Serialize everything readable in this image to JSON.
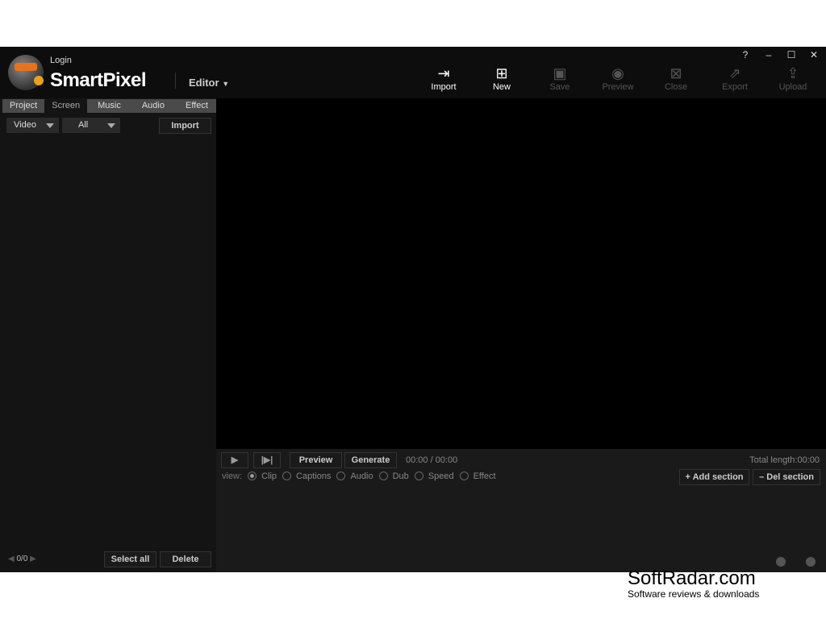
{
  "header": {
    "login": "Login",
    "brand": "SmartPixel",
    "mode": "Editor",
    "toolbar": [
      {
        "label": "Import",
        "icon": "import-icon",
        "enabled": true
      },
      {
        "label": "New",
        "icon": "new-file-icon",
        "enabled": true
      },
      {
        "label": "Save",
        "icon": "save-icon",
        "enabled": false
      },
      {
        "label": "Preview",
        "icon": "eye-icon",
        "enabled": false
      },
      {
        "label": "Close",
        "icon": "close-file-icon",
        "enabled": false
      },
      {
        "label": "Export",
        "icon": "export-icon",
        "enabled": false
      },
      {
        "label": "Upload",
        "icon": "upload-icon",
        "enabled": false
      }
    ],
    "window_controls": {
      "help": "?",
      "minimize": "–",
      "maximize": "☐",
      "close": "✕"
    }
  },
  "left": {
    "tabs": [
      "Project",
      "Screen",
      "Music",
      "Audio",
      "Effect"
    ],
    "active_tab": "Screen",
    "type_select": "Video",
    "filter_select": "All",
    "import": "Import",
    "page": "0/0",
    "select_all": "Select all",
    "delete": "Delete"
  },
  "timeline": {
    "preview": "Preview",
    "generate": "Generate",
    "time": "00:00 / 00:00",
    "total": "Total length:00:00",
    "view_label": "view:",
    "views": [
      "Clip",
      "Captions",
      "Audio",
      "Dub",
      "Speed",
      "Effect"
    ],
    "selected_view": "Clip",
    "add_section": "Add section",
    "del_section": "Del section"
  },
  "watermark": {
    "title": "SoftRadar.com",
    "subtitle": "Software reviews & downloads"
  }
}
